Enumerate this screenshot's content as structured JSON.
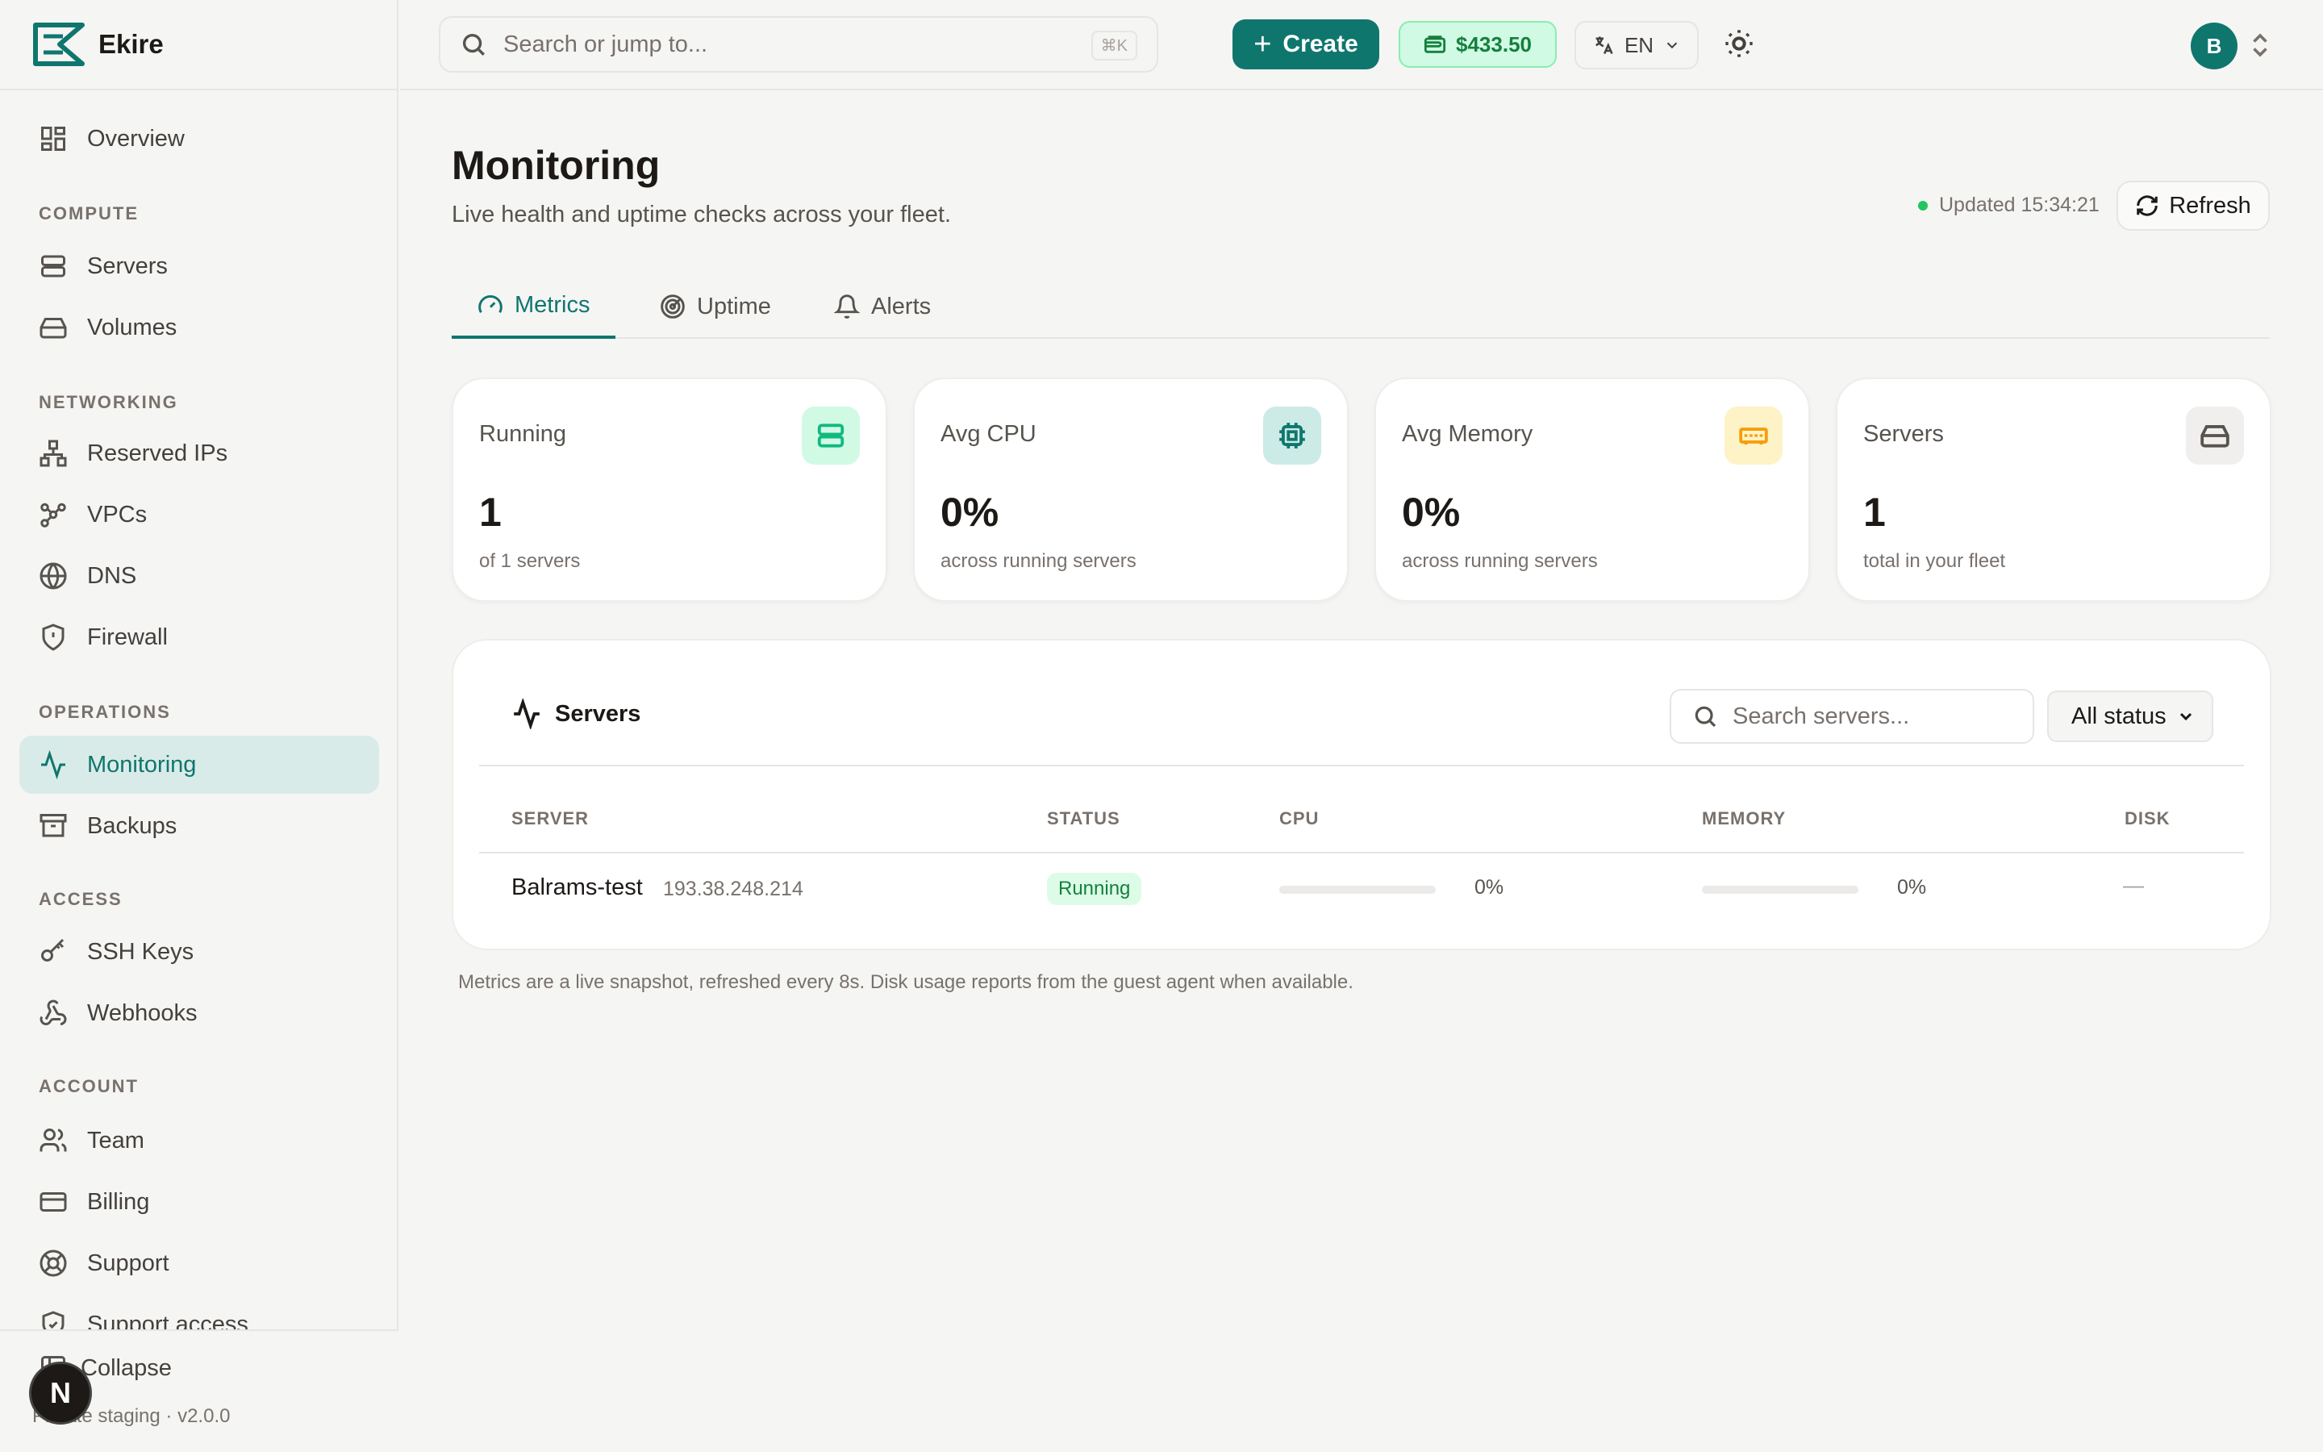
{
  "brand": {
    "name": "Ekire"
  },
  "sidebar": {
    "overview": "Overview",
    "sections": {
      "compute": "COMPUTE",
      "networking": "NETWORKING",
      "operations": "OPERATIONS",
      "access": "ACCESS",
      "account": "ACCOUNT"
    },
    "items": {
      "servers": "Servers",
      "volumes": "Volumes",
      "reserved_ips": "Reserved IPs",
      "vpcs": "VPCs",
      "dns": "DNS",
      "firewall": "Firewall",
      "monitoring": "Monitoring",
      "backups": "Backups",
      "ssh_keys": "SSH Keys",
      "webhooks": "Webhooks",
      "team": "Team",
      "billing": "Billing",
      "support": "Support",
      "support_access": "Support access"
    },
    "collapse": "Collapse",
    "version": "Private staging · v2.0.0",
    "n_badge": "N"
  },
  "topbar": {
    "search_placeholder": "Search or jump to...",
    "search_shortcut": "⌘K",
    "create_label": "Create",
    "balance": "$433.50",
    "language": "EN",
    "avatar_initial": "B"
  },
  "page": {
    "title": "Monitoring",
    "subtitle": "Live health and uptime checks across your fleet.",
    "updated": "Updated 15:34:21",
    "refresh_label": "Refresh"
  },
  "tabs": {
    "metrics": "Metrics",
    "uptime": "Uptime",
    "alerts": "Alerts"
  },
  "cards": [
    {
      "label": "Running",
      "value": "1",
      "note": "of 1 servers"
    },
    {
      "label": "Avg CPU",
      "value": "0%",
      "note": "across running servers"
    },
    {
      "label": "Avg Memory",
      "value": "0%",
      "note": "across running servers"
    },
    {
      "label": "Servers",
      "value": "1",
      "note": "total in your fleet"
    }
  ],
  "servers_panel": {
    "title": "Servers",
    "search_placeholder": "Search servers...",
    "status_filter": "All status",
    "columns": {
      "server": "SERVER",
      "status": "STATUS",
      "cpu": "CPU",
      "memory": "MEMORY",
      "disk": "DISK"
    },
    "rows": [
      {
        "name": "Balrams-test",
        "ip": "193.38.248.214",
        "status": "Running",
        "cpu_pct": "0%",
        "cpu_fraction": 0,
        "memory_pct": "0%",
        "memory_fraction": 0,
        "disk": "—"
      }
    ]
  },
  "footnote": "Metrics are a live snapshot, refreshed every 8s. Disk usage reports from the guest agent when available.",
  "colors": {
    "accent": "#0f766e",
    "success": "#15803d",
    "active_nav_bg": "#d9ebe8"
  }
}
